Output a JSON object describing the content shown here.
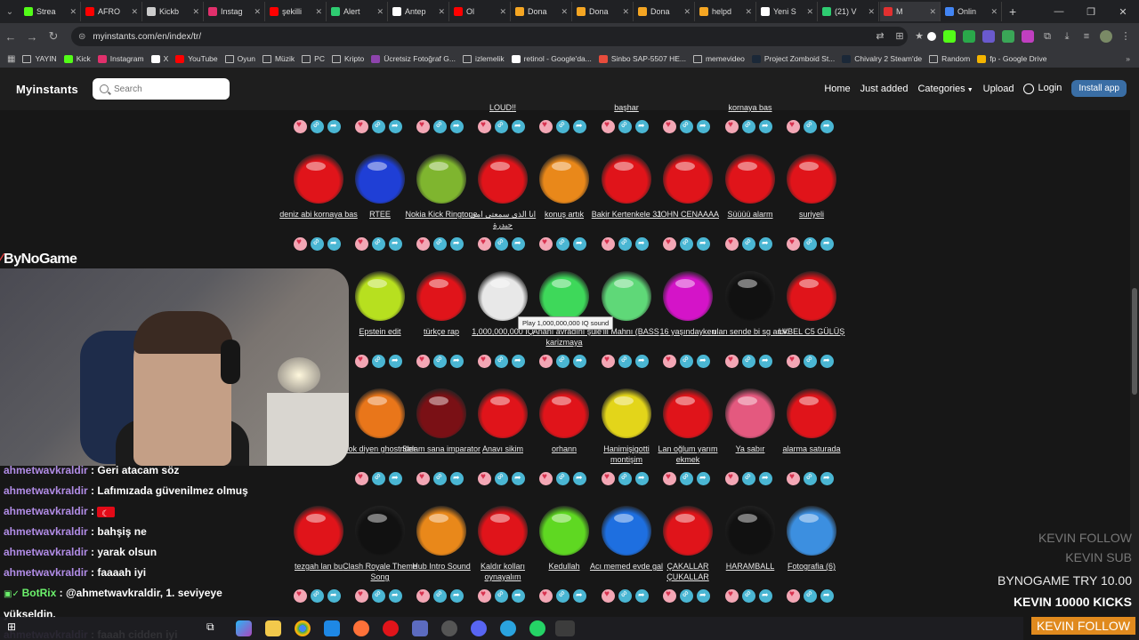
{
  "browser": {
    "tabs": [
      {
        "label": "Strea",
        "color": "#53fc18"
      },
      {
        "label": "AFRO",
        "color": "#ff0000"
      },
      {
        "label": "Kickb",
        "color": "#cccccc"
      },
      {
        "label": "Instag",
        "color": "#e1306c"
      },
      {
        "label": "şekilli",
        "color": "#ff0000"
      },
      {
        "label": "Alert",
        "color": "#2ecc71"
      },
      {
        "label": "Antep",
        "color": "#ffffff"
      },
      {
        "label": "Ol",
        "color": "#ff0000"
      },
      {
        "label": "Dona",
        "color": "#f5a623"
      },
      {
        "label": "Dona",
        "color": "#f5a623"
      },
      {
        "label": "Dona",
        "color": "#f5a623"
      },
      {
        "label": "helpd",
        "color": "#f5a623"
      },
      {
        "label": "Yeni S",
        "color": "#ffffff"
      },
      {
        "label": "(21) V",
        "color": "#2ecc71"
      },
      {
        "label": "M",
        "color": "#e23030",
        "active": true
      },
      {
        "label": "Onlin",
        "color": "#4285f4"
      }
    ],
    "url": "myinstants.com/en/index/tr/",
    "bookmarks": [
      {
        "label": "YAYIN",
        "icon": "folder-icon",
        "color": ""
      },
      {
        "label": "Kick",
        "icon": "kick-icon",
        "color": "#53fc18"
      },
      {
        "label": "Instagram",
        "icon": "instagram-icon",
        "color": "#e1306c"
      },
      {
        "label": "X",
        "icon": "x-icon",
        "color": "#ffffff"
      },
      {
        "label": "YouTube",
        "icon": "youtube-icon",
        "color": "#ff0000"
      },
      {
        "label": "Oyun",
        "icon": "folder-icon",
        "color": ""
      },
      {
        "label": "Müzik",
        "icon": "folder-icon",
        "color": ""
      },
      {
        "label": "PC",
        "icon": "folder-icon",
        "color": ""
      },
      {
        "label": "Kripto",
        "icon": "folder-icon",
        "color": ""
      },
      {
        "label": "Ücretsiz Fotoğraf G...",
        "icon": "photo-icon",
        "color": "#8e44ad"
      },
      {
        "label": "izlemelik",
        "icon": "folder-icon",
        "color": ""
      },
      {
        "label": "retinol - Google'da...",
        "icon": "google-icon",
        "color": "#ffffff"
      },
      {
        "label": "Sinbo SAP-5507 HE...",
        "icon": "shop-icon",
        "color": "#e74c3c"
      },
      {
        "label": "memevideo",
        "icon": "folder-icon",
        "color": ""
      },
      {
        "label": "Project Zomboid St...",
        "icon": "steam-icon",
        "color": "#1b2838"
      },
      {
        "label": "Chivalry 2 Steam'de",
        "icon": "steam-icon",
        "color": "#1b2838"
      },
      {
        "label": "Random",
        "icon": "folder-icon",
        "color": ""
      },
      {
        "label": "fp - Google Drive",
        "icon": "drive-icon",
        "color": "#f4b400"
      }
    ]
  },
  "site": {
    "logo": "Myinstants",
    "search_placeholder": "Search",
    "nav": {
      "home": "Home",
      "just_added": "Just added",
      "categories": "Categories",
      "upload": "Upload",
      "login": "Login",
      "install": "Install app"
    },
    "partial_labels": [
      "LOUD!!",
      "başhar",
      "kornaya bas"
    ],
    "tooltip": "Play 1,000,000,000 IQ sound",
    "rows": [
      [
        {
          "label": "deniz abi kornaya bas",
          "color": "#e0141a"
        },
        {
          "label": "RTEE",
          "color": "#1f3fd6"
        },
        {
          "label": "Nokia Kick Ringtone",
          "color": "#7fb52f"
        },
        {
          "label": "انا الذي سمعتي امي حيدرة",
          "color": "#e0141a"
        },
        {
          "label": "konuş artık",
          "color": "#e9881a"
        },
        {
          "label": "Bakir Kertenkele 31",
          "color": "#e0141a"
        },
        {
          "label": "JOHN CENAAAA",
          "color": "#e0141a"
        },
        {
          "label": "Süüüü alarm",
          "color": "#e0141a"
        },
        {
          "label": "suriyeli",
          "color": "#e0141a"
        }
      ],
      [
        {
          "label": "Epstein edit",
          "color": "#b7e01f"
        },
        {
          "label": "türkçe rap",
          "color": "#e0141a"
        },
        {
          "label": "1,000,000,000 IQ",
          "color": "#e8e8e8"
        },
        {
          "label": "Ananı avradını şu karizmaya",
          "color": "#3ed85a"
        },
        {
          "label": "'le'ili Mahnı (BASS",
          "color": "#5fd878"
        },
        {
          "label": "16 yaşındayken",
          "color": "#d414c8"
        },
        {
          "label": "ulan sende bi sg amk",
          "color": "#111111"
        },
        {
          "label": "LVBEL C5 GÜLÜŞ",
          "color": "#e0141a"
        }
      ],
      [
        {
          "label": "Yok diyen ghostrider",
          "color": "#e9761a"
        },
        {
          "label": "Selam sana imparator",
          "color": "#7a1015"
        },
        {
          "label": "Anavı sikim",
          "color": "#e0141a"
        },
        {
          "label": "orhann",
          "color": "#e0141a"
        },
        {
          "label": "Hanimişigotti montişim",
          "color": "#e3d51a"
        },
        {
          "label": "Lan oğlum yarım ekmek",
          "color": "#e0141a"
        },
        {
          "label": "Ya sabır",
          "color": "#e4597f"
        },
        {
          "label": "alarma saturada",
          "color": "#e0141a"
        }
      ],
      [
        {
          "label": "tezgah lan bu",
          "color": "#e0141a"
        },
        {
          "label": "Clash Royale Theme Song",
          "color": "#111111"
        },
        {
          "label": "Hub Intro Sound",
          "color": "#e9881a"
        },
        {
          "label": "Kaldır kolları oynayalım",
          "color": "#e0141a"
        },
        {
          "label": "Kedullah",
          "color": "#5fd822"
        },
        {
          "label": "Acı memed evde gal",
          "color": "#1e6fe0"
        },
        {
          "label": "ÇAKALLAR ÇUKALLAR",
          "color": "#e0141a"
        },
        {
          "label": "HARAMBALL",
          "color": "#111111"
        },
        {
          "label": "Fotografia (6)",
          "color": "#3c8fe0"
        }
      ]
    ]
  },
  "overlay": {
    "brand": "ByNoGame",
    "chat": [
      {
        "user": "ahmetwavkraldir",
        "text": " : Geri atacam söz"
      },
      {
        "user": "ahmetwavkraldir",
        "text": " : Lafımızada güvenilmez olmuş"
      },
      {
        "user": "ahmetwavkraldir",
        "text": " : ",
        "flag": true
      },
      {
        "user": "ahmetwavkraldir",
        "text": " : bahşiş ne"
      },
      {
        "user": "ahmetwavkraldir",
        "text": " : yarak olsun"
      },
      {
        "user": "ahmetwavkraldir",
        "text": " : faaaah iyi"
      },
      {
        "user": "BotRix",
        "text": " : @ahmetwavkraldir, 1. seviyeye",
        "bot": true
      },
      {
        "user": "",
        "text": "yükseldin."
      },
      {
        "user": "ahmetwavkraldir",
        "text": " : faaah cidden iyi"
      }
    ],
    "ticker": {
      "line1": "KEVIN  FOLLOW",
      "line2": "KEVIN  SUB",
      "line3": "BYNOGAME  TRY 10.00",
      "line4": "KEVIN  10000 KICKS",
      "follow_box": "KEVIN  FOLLOW"
    }
  }
}
